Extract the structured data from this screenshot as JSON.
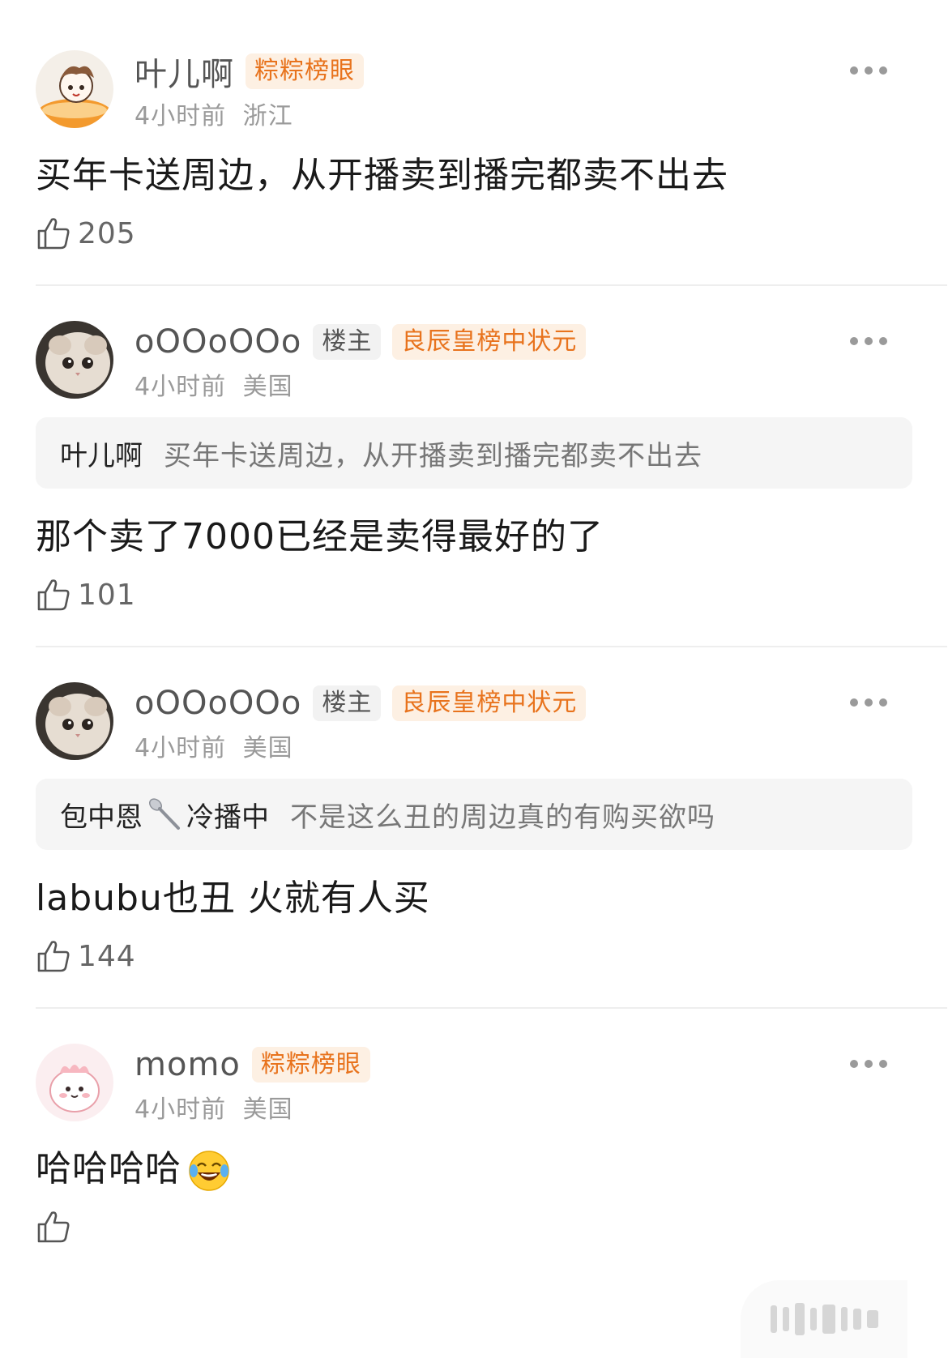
{
  "comments": [
    {
      "username": "叶儿啊",
      "badges": [
        {
          "label": "粽粽榜眼",
          "kind": "rank"
        }
      ],
      "time": "4小时前",
      "location": "浙江",
      "text": "买年卡送周边，从开播卖到播完都卖不出去",
      "likes": "205"
    },
    {
      "username": "oOOoOOo",
      "badges": [
        {
          "label": "楼主",
          "kind": "owner"
        },
        {
          "label": "良辰皇榜中状元",
          "kind": "rank"
        }
      ],
      "time": "4小时前",
      "location": "美国",
      "quote": {
        "user": "叶儿啊",
        "text": "买年卡送周边，从开播卖到播完都卖不出去"
      },
      "text": "那个卖了7000已经是卖得最好的了",
      "likes": "101"
    },
    {
      "username": "oOOoOOo",
      "badges": [
        {
          "label": "楼主",
          "kind": "owner"
        },
        {
          "label": "良辰皇榜中状元",
          "kind": "rank"
        }
      ],
      "time": "4小时前",
      "location": "美国",
      "quote": {
        "user_before_icon": "包中恩",
        "user_icon": "spoon-icon",
        "user_after_icon": "冷播中",
        "text": "不是这么丑的周边真的有购买欲吗"
      },
      "text": "labubu也丑 火就有人买",
      "likes": "144"
    },
    {
      "username": "momo",
      "badges": [
        {
          "label": "粽粽榜眼",
          "kind": "rank"
        }
      ],
      "time": "4小时前",
      "location": "美国",
      "text": "哈哈哈哈",
      "text_emoji": "laughing-tears-emoji",
      "likes": ""
    }
  ],
  "colors": {
    "rank_badge_text": "#e8731d",
    "rank_badge_bg": "#fdf0e3",
    "owner_badge_bg": "#f2f2f2",
    "divider": "#eeeeee"
  }
}
